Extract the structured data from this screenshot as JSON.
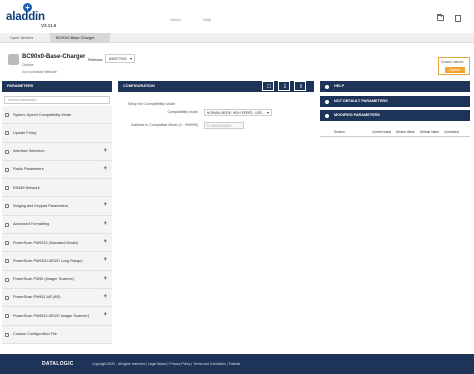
{
  "header": {
    "logo_text": "aladdin",
    "version": "V3.11.6",
    "nav": {
      "home": "Home",
      "help": "Help"
    },
    "icons": [
      "folder-icon",
      "document-icon"
    ]
  },
  "tabs": [
    {
      "label": "Open devices"
    },
    {
      "label": "BC90x0-Base-Charger"
    }
  ],
  "device": {
    "title": "BC90x0-Base-Charger",
    "status": "Online",
    "web": "Go to product Website",
    "release_label": "Release",
    "release_value": "830077630"
  },
  "custom": {
    "label": "Custom manual",
    "button": "Explore"
  },
  "parameters": {
    "header": "PARAMETERS",
    "search_placeholder": "Search parameter...",
    "items": [
      {
        "label": "System Speed Compatibility Mode",
        "expandable": false
      },
      {
        "label": "Update Policy",
        "expandable": false
      },
      {
        "label": "Interface Selection",
        "expandable": true
      },
      {
        "label": "Radio Parameters",
        "expandable": true
      },
      {
        "label": "RS485 Network",
        "expandable": false
      },
      {
        "label": "Staging and Keypad Parameters",
        "expandable": true
      },
      {
        "label": "Advanced Formatting",
        "expandable": true
      },
      {
        "label": "PowerScan PM9310 (Standard Model)",
        "expandable": true
      },
      {
        "label": "PowerScan PM9300 AR/2D Long Range)",
        "expandable": true
      },
      {
        "label": "PowerScan PM95 (Imager Scanner)",
        "expandable": true
      },
      {
        "label": "PowerScan PM951 AR (AR)",
        "expandable": true
      },
      {
        "label": "PowerScan PM9510 AR/2D Imager Scanner)",
        "expandable": true
      },
      {
        "label": "Custom Configuration File",
        "expandable": false
      }
    ]
  },
  "configuration": {
    "header": "CONFIGURATION",
    "buttons": [
      "delete-icon",
      "download-icon",
      "upload-icon"
    ],
    "intro": "Setup the Compatibility Mode",
    "rows": [
      {
        "label": "Compatibility mode",
        "value": "NORMAL MODE: HIGH SPEED - USE..."
      },
      {
        "label": "Address in Compatible Mode (0 - 999999)",
        "value": "0: UNASSIGNED"
      }
    ]
  },
  "side": {
    "help": "HELP",
    "not_default": "NOT DEFAULT PARAMETERS",
    "modified": "MODIFIED PARAMETERS",
    "columns": [
      "Section",
      "Current value",
      "Device Value",
      "Default Value",
      "Command"
    ]
  },
  "footer": {
    "logo": "DATALOGIC",
    "copyright": "Copyright 2020 - All rights reserved | Legal Notice | Privacy Policy | Terms and Conditions | Patents"
  },
  "colors": {
    "navy": "#1e3358",
    "accent": "#f2a531"
  }
}
